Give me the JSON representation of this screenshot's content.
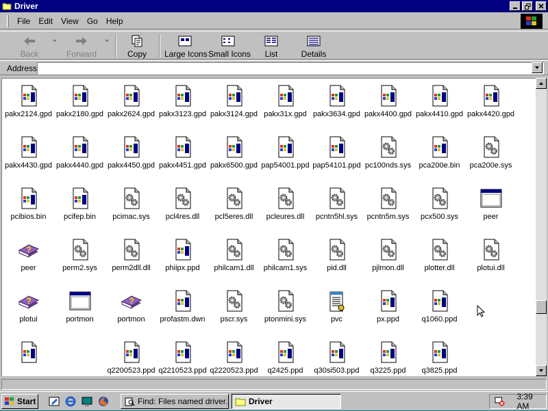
{
  "window": {
    "title": "Driver"
  },
  "menu": [
    "File",
    "Edit",
    "View",
    "Go",
    "Help"
  ],
  "toolbar": {
    "back": "Back",
    "forward": "Forward",
    "copy": "Copy",
    "large_icons": "Large Icons",
    "small_icons": "Small Icons",
    "list": "List",
    "details": "Details"
  },
  "address": {
    "label": "Address",
    "value": ""
  },
  "files": [
    {
      "name": "pakx2124.gpd",
      "type": "doc"
    },
    {
      "name": "pakx2180.gpd",
      "type": "doc"
    },
    {
      "name": "pakx2624.gpd",
      "type": "doc"
    },
    {
      "name": "pakx3123.gpd",
      "type": "doc"
    },
    {
      "name": "pakx3124.gpd",
      "type": "doc"
    },
    {
      "name": "pakx31x.gpd",
      "type": "doc"
    },
    {
      "name": "pakx3634.gpd",
      "type": "doc"
    },
    {
      "name": "pakx4400.gpd",
      "type": "doc"
    },
    {
      "name": "pakx4410.gpd",
      "type": "doc"
    },
    {
      "name": "pakx4420.gpd",
      "type": "doc"
    },
    {
      "name": "pakx4430.gpd",
      "type": "doc"
    },
    {
      "name": "pakx4440.gpd",
      "type": "doc"
    },
    {
      "name": "pakx4450.gpd",
      "type": "doc"
    },
    {
      "name": "pakx4451.gpd",
      "type": "doc"
    },
    {
      "name": "pakx6500.gpd",
      "type": "doc"
    },
    {
      "name": "pap54001.ppd",
      "type": "doc"
    },
    {
      "name": "pap54101.ppd",
      "type": "doc"
    },
    {
      "name": "pc100nds.sys",
      "type": "gear"
    },
    {
      "name": "pca200e.bin",
      "type": "doc"
    },
    {
      "name": "pca200e.sys",
      "type": "gear"
    },
    {
      "name": "pcibios.bin",
      "type": "doc"
    },
    {
      "name": "pcifep.bin",
      "type": "doc"
    },
    {
      "name": "pcimac.sys",
      "type": "gear"
    },
    {
      "name": "pcl4res.dll",
      "type": "gear"
    },
    {
      "name": "pcl5eres.dll",
      "type": "gear"
    },
    {
      "name": "pcleures.dll",
      "type": "gear"
    },
    {
      "name": "pcntn5hl.sys",
      "type": "gear"
    },
    {
      "name": "pcntn5m.sys",
      "type": "gear"
    },
    {
      "name": "pcx500.sys",
      "type": "gear"
    },
    {
      "name": "peer",
      "type": "window"
    },
    {
      "name": "peer",
      "type": "help"
    },
    {
      "name": "perm2.sys",
      "type": "gear"
    },
    {
      "name": "perm2dll.dll",
      "type": "gear"
    },
    {
      "name": "phiipx.ppd",
      "type": "doc"
    },
    {
      "name": "philcam1.dll",
      "type": "gear"
    },
    {
      "name": "philcam1.sys",
      "type": "gear"
    },
    {
      "name": "pid.dll",
      "type": "gear"
    },
    {
      "name": "pjlmon.dll",
      "type": "gear"
    },
    {
      "name": "plotter.dll",
      "type": "gear"
    },
    {
      "name": "plotui.dll",
      "type": "gear"
    },
    {
      "name": "plotui",
      "type": "help"
    },
    {
      "name": "portmon",
      "type": "window"
    },
    {
      "name": "portmon",
      "type": "help"
    },
    {
      "name": "profastm.dwn",
      "type": "doc"
    },
    {
      "name": "pscr.sys",
      "type": "gear"
    },
    {
      "name": "ptonmini.sys",
      "type": "gear"
    },
    {
      "name": "pvc",
      "type": "notepad"
    },
    {
      "name": "px.ppd",
      "type": "doc"
    },
    {
      "name": "q1060.ppd",
      "type": "doc"
    },
    {
      "name": "",
      "type": "none"
    },
    {
      "name": "",
      "type": "doc"
    },
    {
      "name": "",
      "type": "none"
    },
    {
      "name": "q2200523.ppd",
      "type": "doc"
    },
    {
      "name": "q2210523.ppd",
      "type": "doc"
    },
    {
      "name": "q2220523.ppd",
      "type": "doc"
    },
    {
      "name": "q2425.ppd",
      "type": "doc"
    },
    {
      "name": "q30si503.ppd",
      "type": "doc"
    },
    {
      "name": "q3225.ppd",
      "type": "doc"
    },
    {
      "name": "q3825.ppd",
      "type": "doc"
    }
  ],
  "taskbar": {
    "start": "Start",
    "tasks": [
      {
        "label": "Find: Files named driver.cab",
        "active": false
      },
      {
        "label": "Driver",
        "active": true
      }
    ],
    "clock": "3:39 AM"
  }
}
